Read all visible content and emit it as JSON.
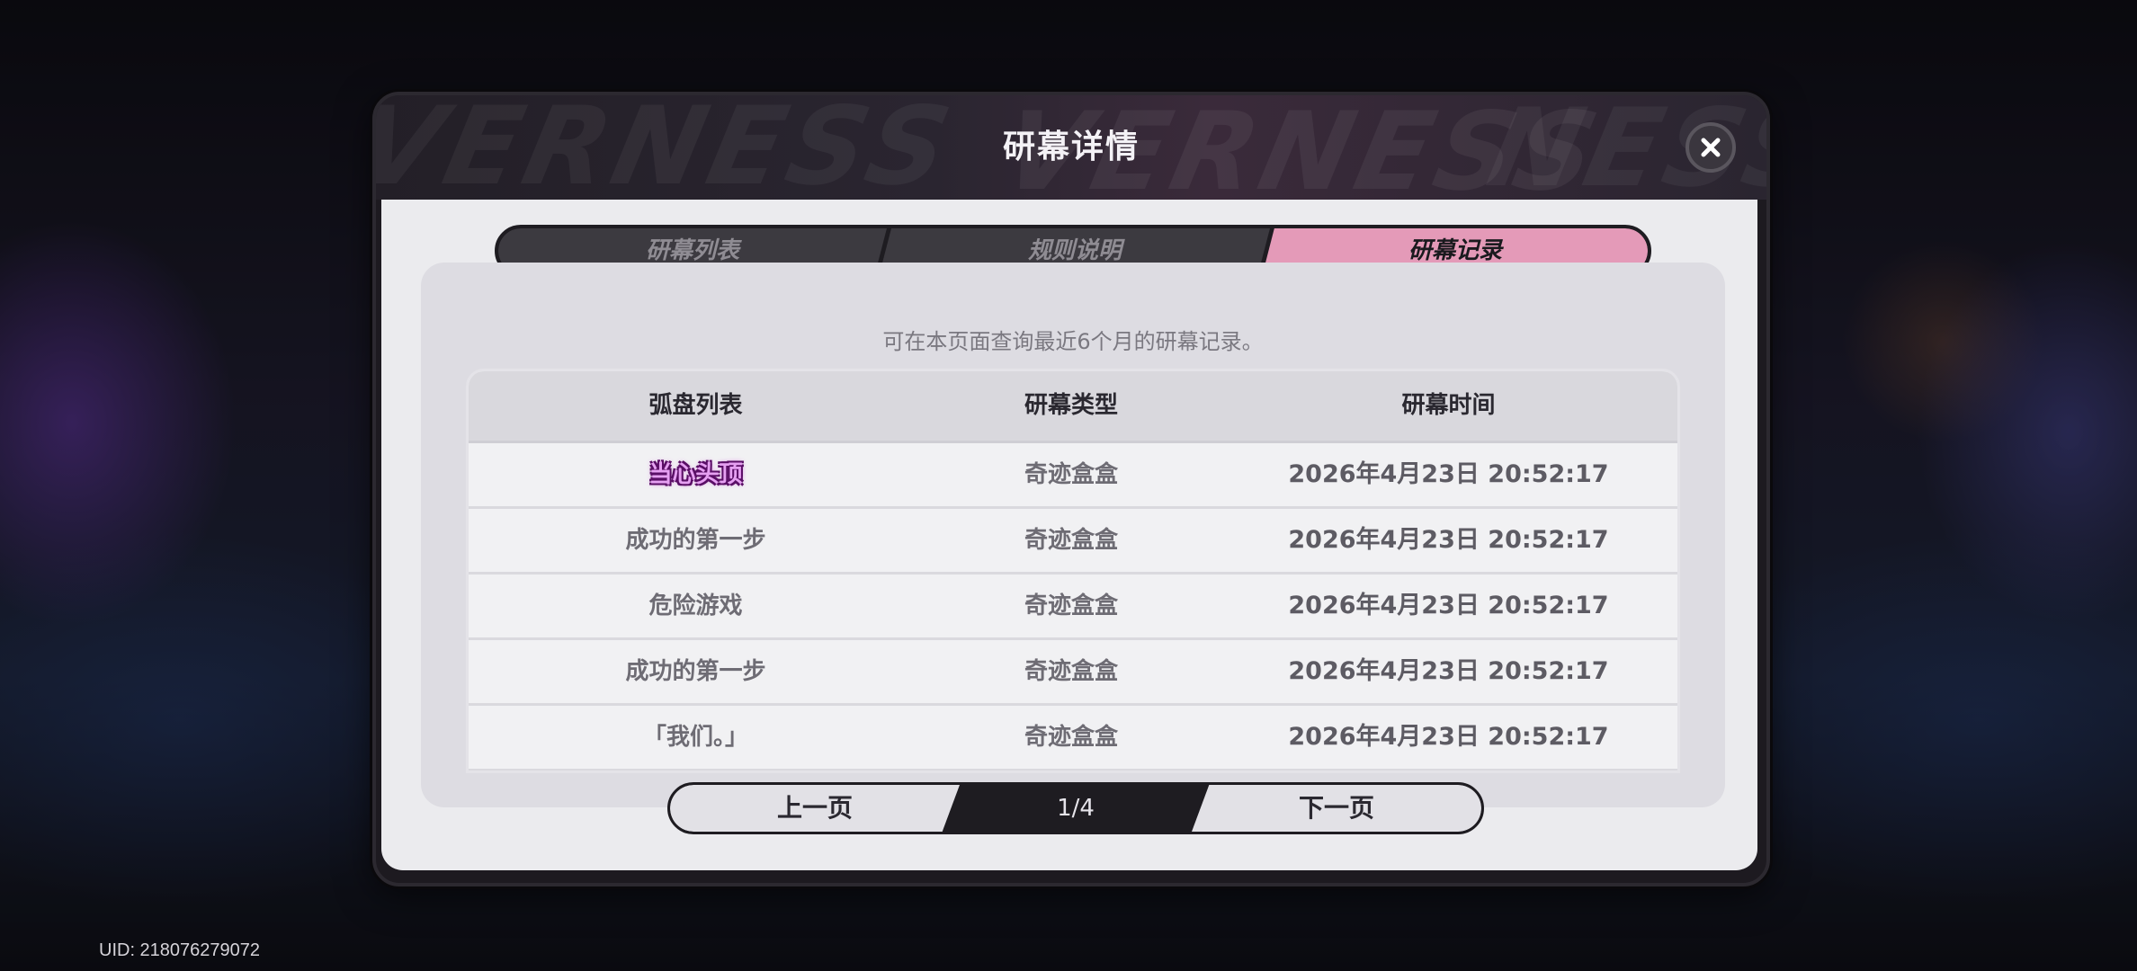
{
  "modal": {
    "title": "研幕详情",
    "header_deco": [
      "VERNESS",
      "VERNESS",
      "NESS"
    ]
  },
  "tabs": [
    {
      "label": "研幕列表",
      "active": false
    },
    {
      "label": "规则说明",
      "active": false
    },
    {
      "label": "研幕记录",
      "active": true
    }
  ],
  "notice": "可在本页面查询最近6个月的研幕记录。",
  "table": {
    "columns": [
      "弧盘列表",
      "研幕类型",
      "研幕时间"
    ],
    "rows": [
      {
        "name": "当心头顶",
        "type": "奇迹盒盒",
        "time": "2026年4月23日 20:52:17",
        "highlight": true
      },
      {
        "name": "成功的第一步",
        "type": "奇迹盒盒",
        "time": "2026年4月23日 20:52:17",
        "highlight": false
      },
      {
        "name": "危险游戏",
        "type": "奇迹盒盒",
        "time": "2026年4月23日 20:52:17",
        "highlight": false
      },
      {
        "name": "成功的第一步",
        "type": "奇迹盒盒",
        "time": "2026年4月23日 20:52:17",
        "highlight": false
      },
      {
        "name": "「我们。」",
        "type": "奇迹盒盒",
        "time": "2026年4月23日 20:52:17",
        "highlight": false
      }
    ]
  },
  "pager": {
    "prev_label": "上一页",
    "next_label": "下一页",
    "indicator": "1/4"
  },
  "uid": "UID: 218076279072",
  "colors": {
    "active_tab": "#e49ab8",
    "highlight_name": "#e6a0f2"
  },
  "icons": {
    "close": "close-icon"
  }
}
